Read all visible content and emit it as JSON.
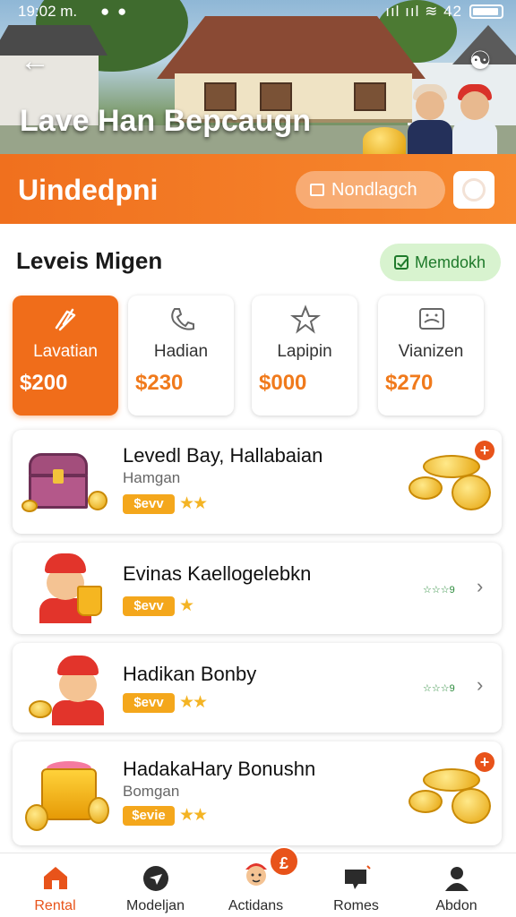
{
  "status_bar": {
    "time": "19:02 m.",
    "icons": "● ●",
    "signal": "ııl ııl ≋ 42"
  },
  "hero": {
    "title": "Lave Han Bepcaugn",
    "back_icon": "arrow-left-icon",
    "share_icon": "share-icon"
  },
  "header": {
    "title": "Uindedpni",
    "pill_label": "Nondlagch"
  },
  "section": {
    "title": "Leveis Migen",
    "badge_label": "Memdokh"
  },
  "categories": [
    {
      "icon": "megaphone-icon",
      "label": "Lavatian",
      "price": "$200",
      "active": true
    },
    {
      "icon": "phone-icon",
      "label": "Hadian",
      "price": "$230",
      "active": false
    },
    {
      "icon": "star-icon",
      "label": "Lapipin",
      "price": "$000",
      "active": false
    },
    {
      "icon": "image-icon",
      "label": "Vianizen",
      "price": "$270",
      "active": false
    }
  ],
  "items": [
    {
      "title": "Levedl Bay, Hallabaian",
      "subtitle": "Hamgan",
      "price": "$evv",
      "stars": "★★",
      "action": "plus"
    },
    {
      "title": "Evinas Kaellogelebkn",
      "subtitle": "",
      "price": "$evv",
      "stars": "★",
      "mini_rating": "☆☆☆9",
      "action": "chevron"
    },
    {
      "title": "Hadikan Bonby",
      "subtitle": "",
      "price": "$evv",
      "stars": "★★",
      "mini_rating": "☆☆☆9",
      "action": "chevron"
    },
    {
      "title": "HadakaHary Bonushn",
      "subtitle": "Bomgan",
      "price": "$evie",
      "stars": "★★",
      "action": "plus"
    }
  ],
  "bottom_nav": [
    {
      "icon": "home-icon",
      "label": "Rental",
      "active": true
    },
    {
      "icon": "compass-icon",
      "label": "Modeljan",
      "active": false
    },
    {
      "icon": "mascot-icon",
      "label": "Actidans",
      "active": false,
      "badge": "£"
    },
    {
      "icon": "chat-icon",
      "label": "Romes",
      "active": false
    },
    {
      "icon": "user-icon",
      "label": "Abdon",
      "active": false
    }
  ],
  "colors": {
    "accent": "#f06d1a",
    "badge_green": "#d8f3cf",
    "gold": "#f4a71c"
  }
}
